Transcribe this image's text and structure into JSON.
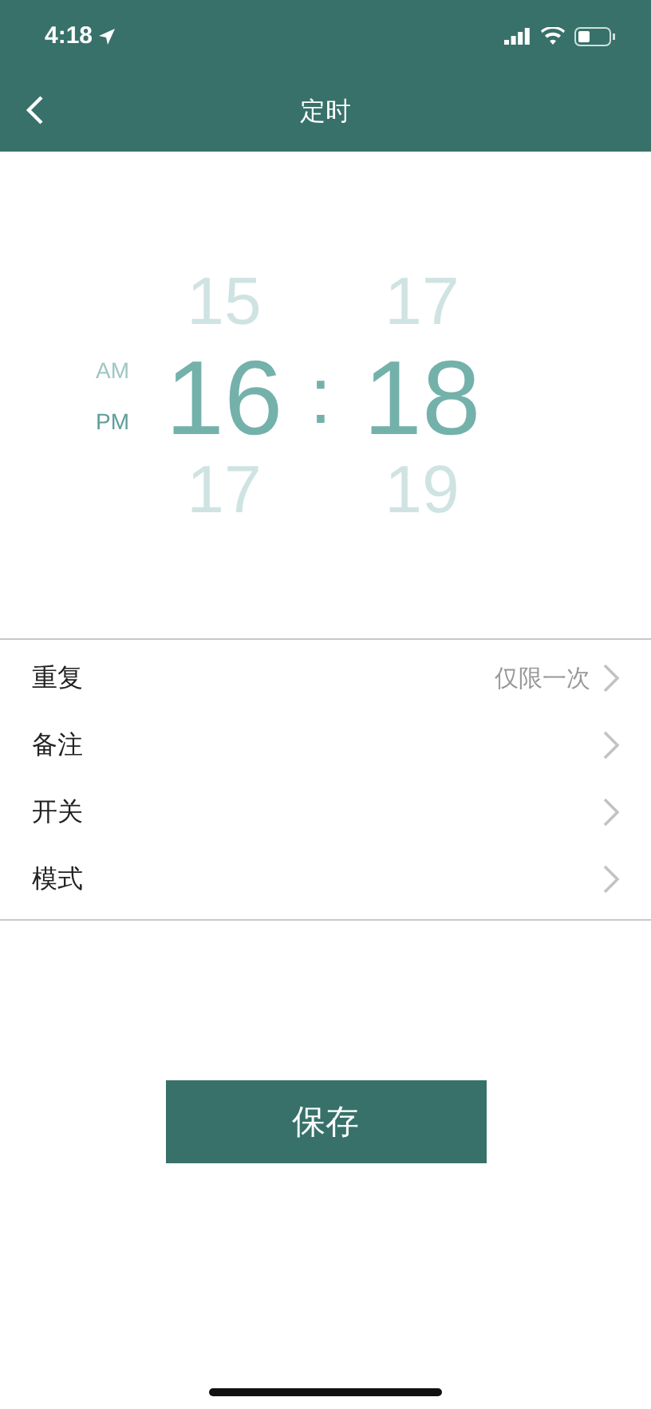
{
  "status_bar": {
    "time": "4:18"
  },
  "nav": {
    "title": "定时"
  },
  "picker": {
    "periods": [
      {
        "label": "AM",
        "selected": false
      },
      {
        "label": "PM",
        "selected": true
      }
    ],
    "hours": [
      {
        "label": "15",
        "selected": false
      },
      {
        "label": "16",
        "selected": true
      },
      {
        "label": "17",
        "selected": false
      }
    ],
    "separator": ":",
    "minutes": [
      {
        "label": "17",
        "selected": false
      },
      {
        "label": "18",
        "selected": true
      },
      {
        "label": "19",
        "selected": false
      }
    ]
  },
  "settings": [
    {
      "label": "重复",
      "value": "仅限一次"
    },
    {
      "label": "备注"
    },
    {
      "label": "开关"
    },
    {
      "label": "模式"
    }
  ],
  "save_button": "保存"
}
